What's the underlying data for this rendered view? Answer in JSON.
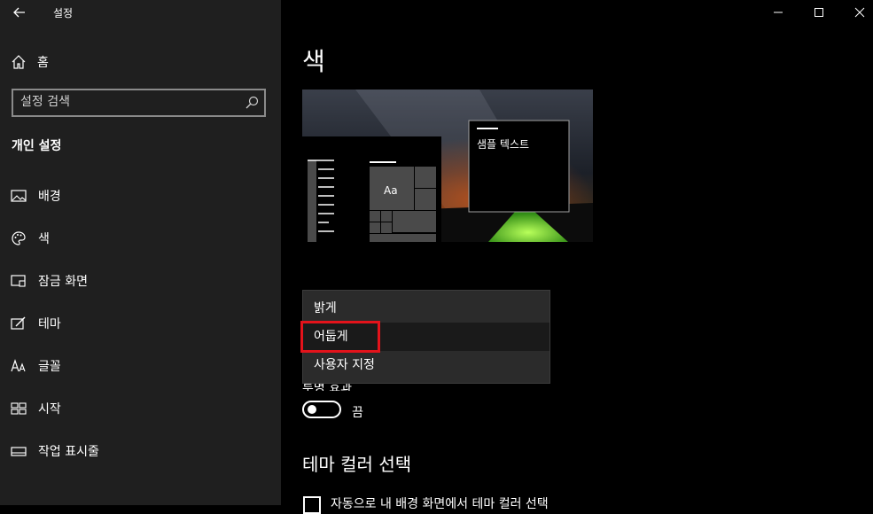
{
  "window": {
    "title": "설정"
  },
  "sidebar": {
    "home_label": "홈",
    "search_placeholder": "설정 검색",
    "section_heading": "개인 설정",
    "items": [
      {
        "label": "배경",
        "icon": "picture-icon"
      },
      {
        "label": "색",
        "icon": "palette-icon"
      },
      {
        "label": "잠금 화면",
        "icon": "lock-screen-icon"
      },
      {
        "label": "테마",
        "icon": "theme-icon"
      },
      {
        "label": "글꼴",
        "icon": "font-icon"
      },
      {
        "label": "시작",
        "icon": "start-icon"
      },
      {
        "label": "작업 표시줄",
        "icon": "taskbar-icon"
      }
    ]
  },
  "main": {
    "title": "색",
    "preview": {
      "sample_text": "샘플 텍스트",
      "tile_text": "Aa"
    },
    "theme_dropdown": {
      "options": [
        "밝게",
        "어둡게",
        "사용자 지정"
      ],
      "selected": "어둡게"
    },
    "transparency": {
      "label": "투명 효과",
      "state": "끔"
    },
    "theme_color_heading": "테마 컬러 선택",
    "auto_color_checkbox_label": "자동으로 내 배경 화면에서 테마 컬러 선택"
  },
  "colors": {
    "sidebar_bg": "#1f1f1f",
    "main_bg": "#000000",
    "highlight": "#e3131b",
    "accent_green": "#66cc22"
  }
}
